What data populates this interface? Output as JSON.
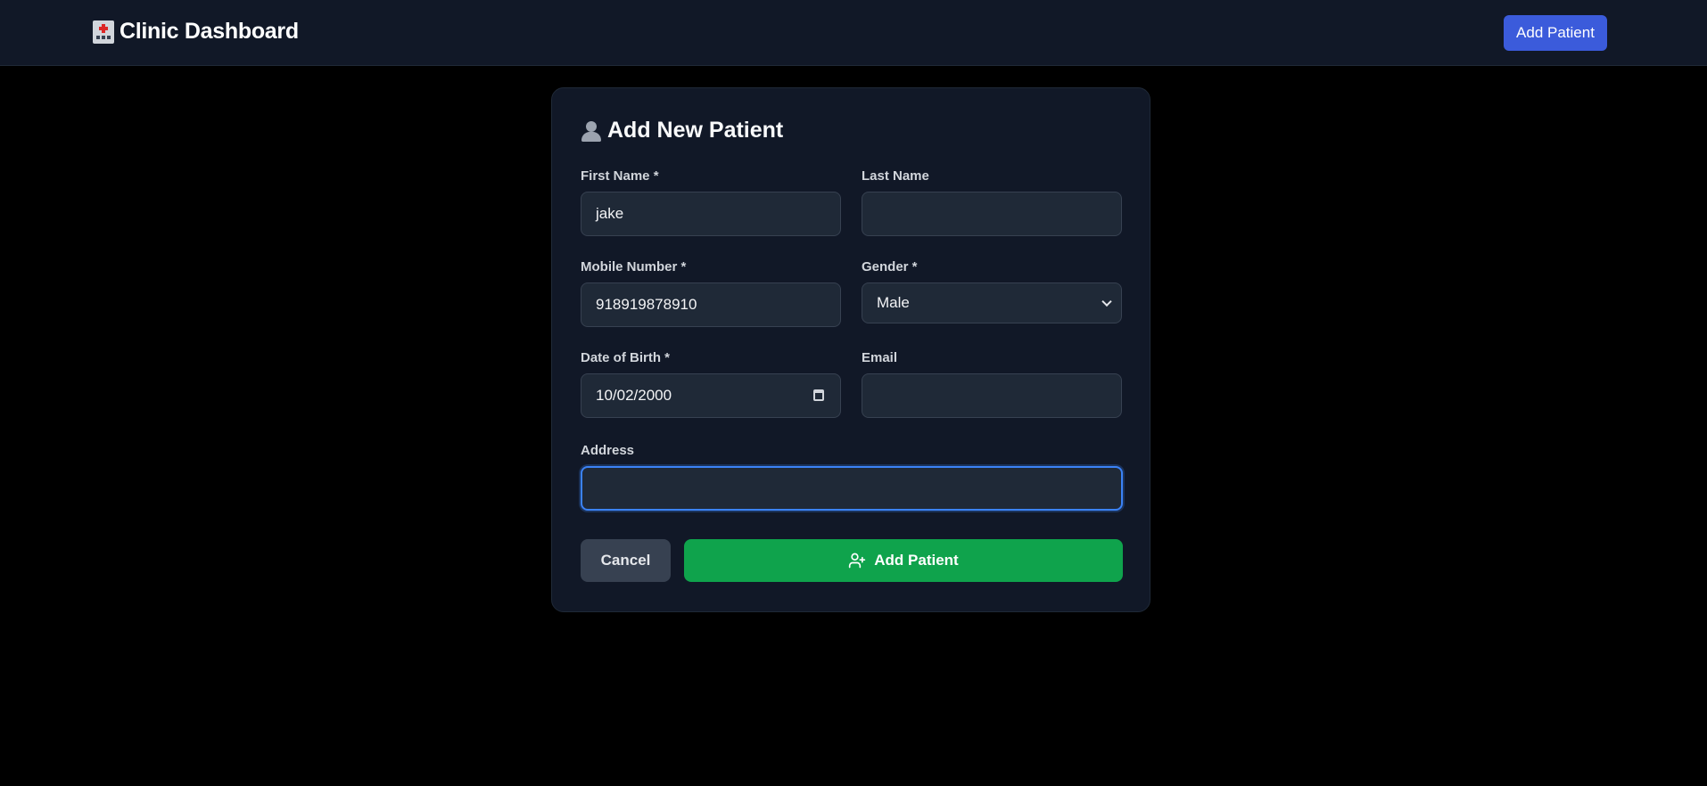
{
  "header": {
    "title": "Clinic Dashboard",
    "brand_icon": "hospital-icon",
    "add_patient_label": "Add Patient"
  },
  "form": {
    "title": "Add New Patient",
    "title_icon": "person-icon",
    "first_name": {
      "label": "First Name *",
      "value": "jake"
    },
    "last_name": {
      "label": "Last Name",
      "value": ""
    },
    "mobile": {
      "label": "Mobile Number *",
      "value": "918919878910"
    },
    "gender": {
      "label": "Gender *",
      "value": "Male"
    },
    "dob": {
      "label": "Date of Birth *",
      "value": "10/02/2000"
    },
    "email": {
      "label": "Email",
      "value": ""
    },
    "address": {
      "label": "Address",
      "value": ""
    },
    "cancel_label": "Cancel",
    "submit_label": "Add Patient",
    "submit_icon": "user-plus-icon"
  },
  "colors": {
    "background": "#000000",
    "navbar": "#111827",
    "card": "#111827",
    "primary": "#3b5bdb",
    "success": "#0fa34c",
    "focus": "#3b82f6"
  }
}
